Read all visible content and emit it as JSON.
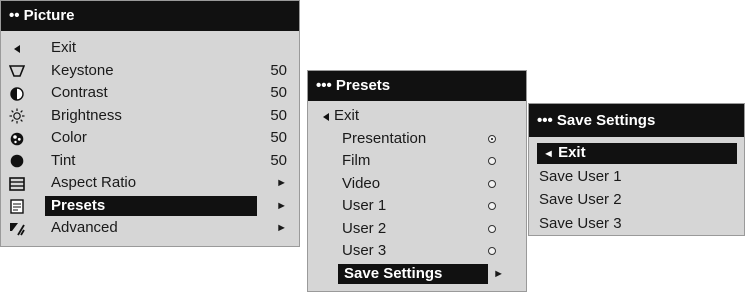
{
  "picture_menu": {
    "title": "•• Picture",
    "items": [
      {
        "label": "Exit",
        "value": "",
        "icon": "left-arrow-icon"
      },
      {
        "label": "Keystone",
        "value": "50",
        "icon": "keystone-icon"
      },
      {
        "label": "Contrast",
        "value": "50",
        "icon": "contrast-icon"
      },
      {
        "label": "Brightness",
        "value": "50",
        "icon": "brightness-icon"
      },
      {
        "label": "Color",
        "value": "50",
        "icon": "color-icon"
      },
      {
        "label": "Tint",
        "value": "50",
        "icon": "tint-icon"
      },
      {
        "label": "Aspect Ratio",
        "value": "►",
        "icon": "aspect-ratio-icon"
      },
      {
        "label": "Presets",
        "value": "►",
        "icon": "presets-icon",
        "selected": true
      },
      {
        "label": "Advanced",
        "value": "►",
        "icon": "advanced-icon"
      }
    ]
  },
  "presets_menu": {
    "title": "••• Presets",
    "exit_label": "Exit",
    "items": [
      {
        "label": "Presentation",
        "checked": true
      },
      {
        "label": "Film",
        "checked": false
      },
      {
        "label": "Video",
        "checked": false
      },
      {
        "label": "User 1",
        "checked": false
      },
      {
        "label": "User 2",
        "checked": false
      },
      {
        "label": "User 3",
        "checked": false
      }
    ],
    "save_settings_label": "Save Settings",
    "save_settings_arrow": "►"
  },
  "save_menu": {
    "title": "••• Save Settings",
    "exit_label": "Exit",
    "items": [
      "Save User 1",
      "Save User 2",
      "Save User 3"
    ]
  },
  "glyphs": {
    "left_arrow": "◄"
  }
}
